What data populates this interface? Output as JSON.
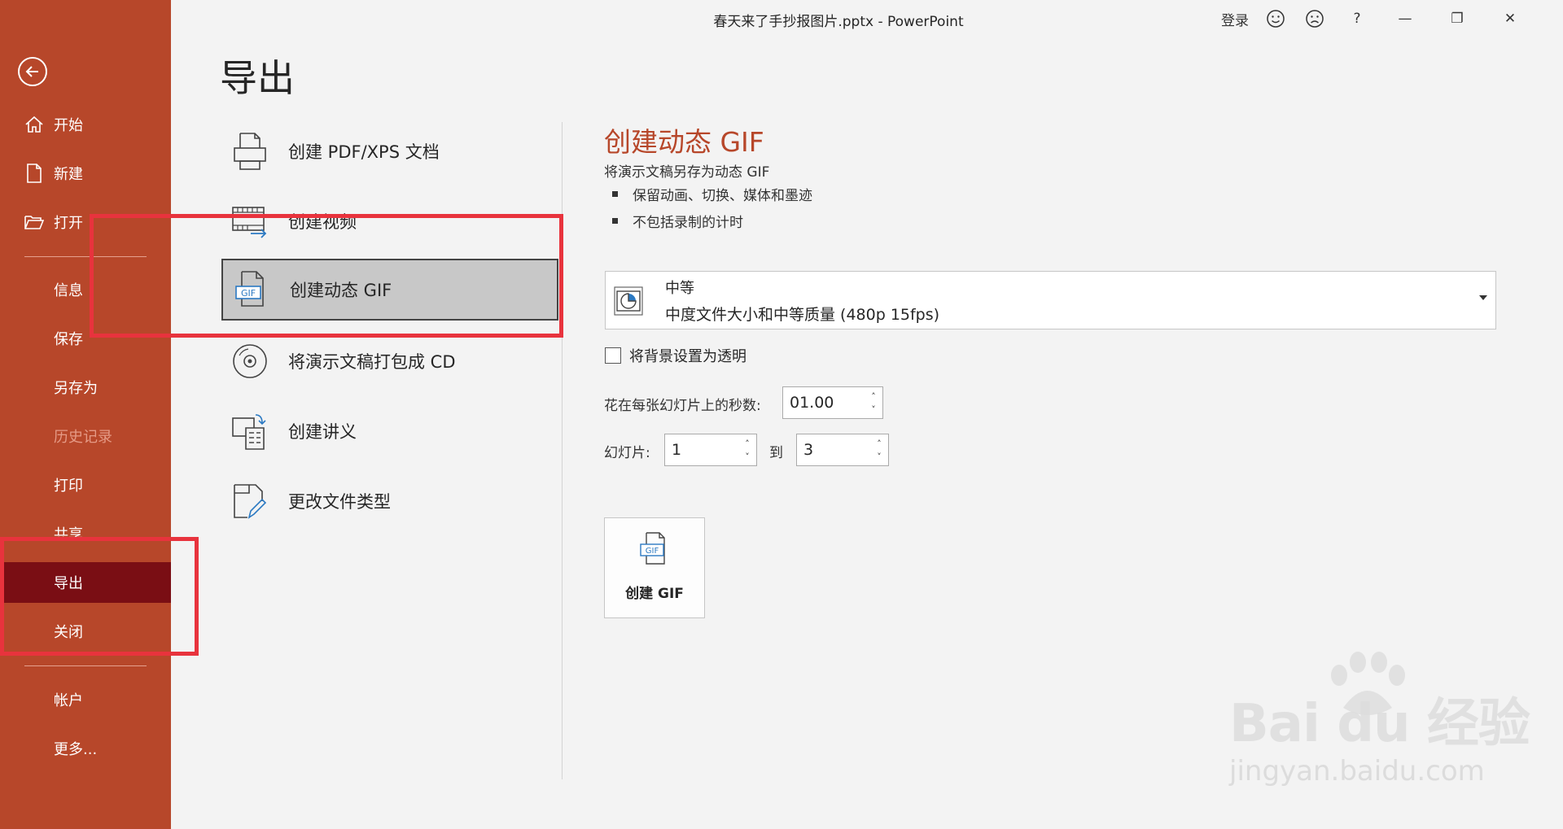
{
  "window": {
    "title": "春天来了手抄报图片.pptx  -  PowerPoint",
    "signin": "登录",
    "help": "?",
    "minimize": "—",
    "restore": "❐",
    "close": "✕"
  },
  "sidebar": {
    "items": [
      {
        "label": "开始",
        "icon": "home-icon"
      },
      {
        "label": "新建",
        "icon": "new-document-icon"
      },
      {
        "label": "打开",
        "icon": "open-folder-icon"
      },
      {
        "label": "信息"
      },
      {
        "label": "保存"
      },
      {
        "label": "另存为"
      },
      {
        "label": "历史记录",
        "state": "disabled"
      },
      {
        "label": "打印"
      },
      {
        "label": "共享"
      },
      {
        "label": "导出",
        "state": "active"
      },
      {
        "label": "关闭"
      },
      {
        "label": "帐户"
      },
      {
        "label": "更多..."
      }
    ]
  },
  "page": {
    "title": "导出"
  },
  "export_options": [
    {
      "label": "创建 PDF/XPS 文档",
      "icon": "pdf-xps-icon"
    },
    {
      "label": "创建视频",
      "icon": "video-icon"
    },
    {
      "label": "创建动态 GIF",
      "icon": "gif-icon",
      "selected": true
    },
    {
      "label": "将演示文稿打包成 CD",
      "icon": "cd-icon"
    },
    {
      "label": "创建讲义",
      "icon": "handout-icon"
    },
    {
      "label": "更改文件类型",
      "icon": "change-file-type-icon"
    }
  ],
  "panel": {
    "title": "创建动态 GIF",
    "description": "将演示文稿另存为动态 GIF",
    "bullets": [
      "保留动画、切换、媒体和墨迹",
      "不包括录制的计时"
    ],
    "quality": {
      "selected": "中等",
      "detail": "中度文件大小和中等质量 (480p 15fps)"
    },
    "transparent_bg": {
      "label": "将背景设置为透明",
      "checked": false
    },
    "seconds": {
      "label": "花在每张幻灯片上的秒数:",
      "value": "01.00"
    },
    "slides": {
      "label": "幻灯片:",
      "from": "1",
      "to_label": "到",
      "to": "3"
    },
    "create_button": {
      "label": "创建 GIF",
      "icon_text": "GIF"
    }
  },
  "watermark": {
    "main": "Bai du 经验",
    "sub": "jingyan.baidu.com"
  },
  "colors": {
    "sidebar": "#b7472a",
    "sidebar_active": "#7a0e14",
    "accent": "#b7472a",
    "highlight": "#e8333d"
  }
}
